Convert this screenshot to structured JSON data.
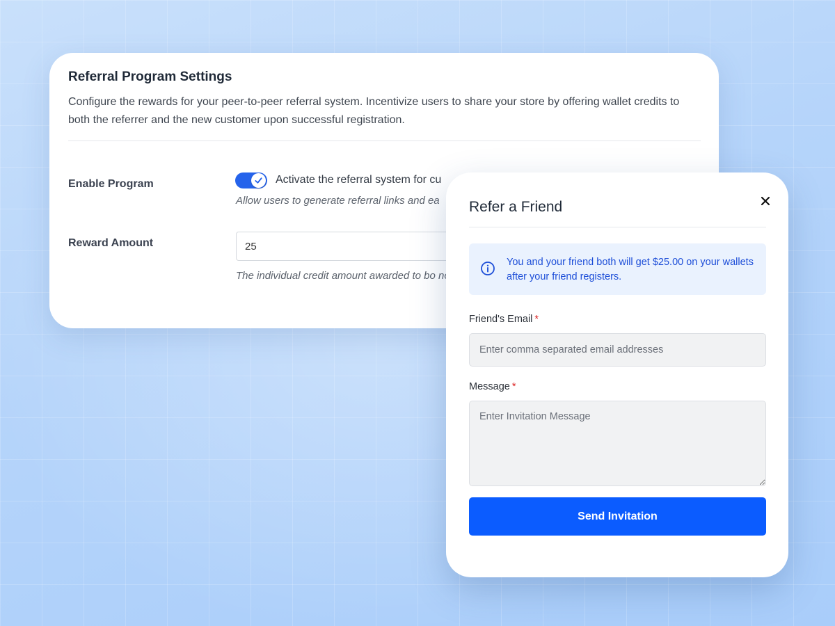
{
  "settings": {
    "title": "Referral Program Settings",
    "description": "Configure the rewards for your peer-to-peer referral system. Incentivize users to share your store by offering wallet credits to both the referrer and the new customer upon successful registration.",
    "enable_label": "Enable Program",
    "enable_toggle_on": true,
    "enable_toggle_text": "Activate the referral system for cu",
    "enable_help": "Allow users to generate referral links and ea",
    "reward_label": "Reward Amount",
    "reward_value": "25",
    "reward_help": "The individual credit amount awarded to bo no reward."
  },
  "modal": {
    "title": "Refer a Friend",
    "close_icon": "close-icon",
    "info_icon": "info-icon",
    "info_text": "You and your friend both will get $25.00 on your wallets after your friend registers.",
    "email_label": "Friend's Email",
    "email_required": "*",
    "email_placeholder": "Enter comma separated email addresses",
    "message_label": "Message",
    "message_required": "*",
    "message_placeholder": "Enter Invitation Message",
    "send_label": "Send Invitation"
  },
  "colors": {
    "accent": "#0b5cff",
    "toggle": "#2563eb",
    "info_bg": "#eaf2fe",
    "info_text": "#1d4ed8",
    "required": "#dc2626"
  }
}
